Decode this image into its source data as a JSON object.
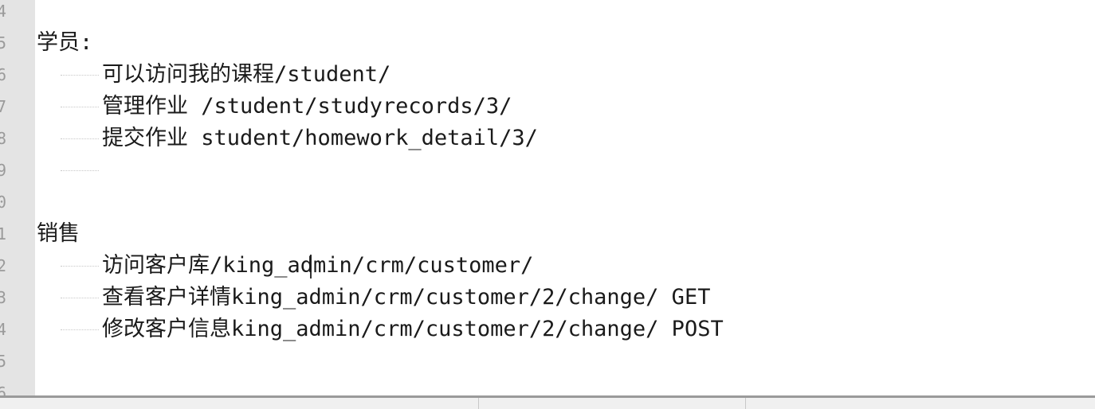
{
  "editor": {
    "line_numbers": [
      "4",
      "5",
      "6",
      "7",
      "8",
      "9",
      "0",
      "1",
      "2",
      "3",
      "4",
      "5",
      "6"
    ],
    "lines": [
      {
        "text": ""
      },
      {
        "text": "学员:"
      },
      {
        "text": "可以访问我的课程/student/"
      },
      {
        "text": "管理作业 /student/studyrecords/3/"
      },
      {
        "text": "提交作业 student/homework_detail/3/"
      },
      {
        "text": ""
      },
      {
        "text": ""
      },
      {
        "text": "销售"
      },
      {
        "text": "访问客户库/king_admin/crm/customer/"
      },
      {
        "text": "查看客户详情king_admin/crm/customer/2/change/ GET"
      },
      {
        "text": "修改客户信息king_admin/crm/customer/2/change/ POST"
      },
      {
        "text": ""
      },
      {
        "text": ""
      }
    ]
  }
}
